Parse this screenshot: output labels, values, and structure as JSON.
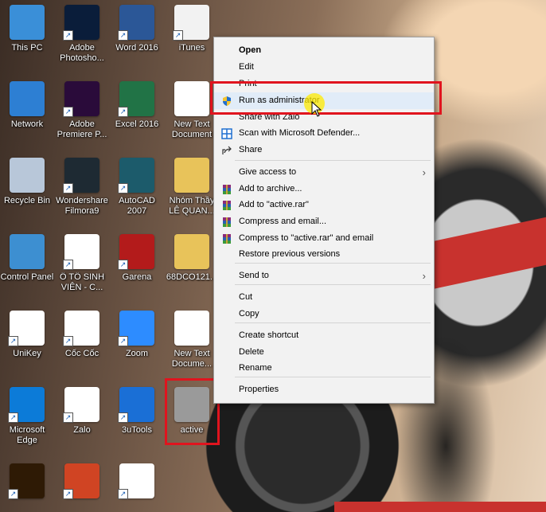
{
  "desktop_icons": [
    {
      "label": "This PC",
      "icon": "computer-icon",
      "color": "#3a8fd8"
    },
    {
      "label": "Adobe Photosho...",
      "icon": "photoshop-icon",
      "color": "#0a1d3a"
    },
    {
      "label": "Word 2016",
      "icon": "word-icon",
      "color": "#2b5797"
    },
    {
      "label": "iTunes",
      "icon": "itunes-icon",
      "color": "#f2f2f2"
    },
    {
      "label": "Network",
      "icon": "network-icon",
      "color": "#2d7fd3"
    },
    {
      "label": "Adobe Premiere P...",
      "icon": "premiere-icon",
      "color": "#2a0b3a"
    },
    {
      "label": "Excel 2016",
      "icon": "excel-icon",
      "color": "#217346"
    },
    {
      "label": "New Text Document",
      "icon": "text-document-icon",
      "color": "#ffffff"
    },
    {
      "label": "Recycle Bin",
      "icon": "recycle-bin-icon",
      "color": "#b8c7d9"
    },
    {
      "label": "Wondershare Filmora9",
      "icon": "filmora-icon",
      "color": "#1e2a33"
    },
    {
      "label": "AutoCAD 2007",
      "icon": "autocad-icon",
      "color": "#1c5b6b"
    },
    {
      "label": "Nhóm Thầy LÊ QUAN...",
      "icon": "folder-icon",
      "color": "#e8c35a"
    },
    {
      "label": "Control Panel",
      "icon": "control-panel-icon",
      "color": "#3d8fd1"
    },
    {
      "label": "Ô TÔ SINH VIÊN - C...",
      "icon": "chrome-icon",
      "color": "#ffffff"
    },
    {
      "label": "Garena",
      "icon": "garena-icon",
      "color": "#b31b1b"
    },
    {
      "label": "68DCO121...",
      "icon": "folder-icon",
      "color": "#e8c35a"
    },
    {
      "label": "UniKey",
      "icon": "unikey-icon",
      "color": "#ffffff"
    },
    {
      "label": "Cốc Cốc",
      "icon": "coccoc-icon",
      "color": "#ffffff"
    },
    {
      "label": "Zoom",
      "icon": "zoom-icon",
      "color": "#2d8cff"
    },
    {
      "label": "New Text Docume...",
      "icon": "text-document-icon",
      "color": "#ffffff"
    },
    {
      "label": "Microsoft Edge",
      "icon": "edge-icon",
      "color": "#0c7bd8"
    },
    {
      "label": "Zalo",
      "icon": "zalo-icon",
      "color": "#ffffff"
    },
    {
      "label": "3uTools",
      "icon": "3utools-icon",
      "color": "#1a6fd6"
    },
    {
      "label": "active",
      "icon": "batch-file-icon",
      "color": "#9a9a9a"
    },
    {
      "label": "",
      "icon": "illustrator-icon",
      "color": "#2e1a05"
    },
    {
      "label": "",
      "icon": "powerpoint-icon",
      "color": "#d04423"
    },
    {
      "label": "",
      "icon": "winrar-icon",
      "color": "#ffffff"
    }
  ],
  "context_menu": {
    "items": [
      {
        "label": "Open",
        "bold": true,
        "icon": ""
      },
      {
        "label": "Edit",
        "icon": ""
      },
      {
        "label": "Print",
        "icon": ""
      },
      {
        "label": "Run as administrator",
        "icon": "shield-icon",
        "highlighted": true
      },
      {
        "label": "Share with Zalo",
        "icon": ""
      },
      {
        "label": "Scan with Microsoft Defender...",
        "icon": "defender-icon"
      },
      {
        "label": "Share",
        "icon": "share-icon"
      },
      {
        "label": "Give access to",
        "icon": "",
        "submenu": true
      },
      {
        "label": "Add to archive...",
        "icon": "winrar-icon"
      },
      {
        "label": "Add to \"active.rar\"",
        "icon": "winrar-icon"
      },
      {
        "label": "Compress and email...",
        "icon": "winrar-icon"
      },
      {
        "label": "Compress to \"active.rar\" and email",
        "icon": "winrar-icon"
      },
      {
        "label": "Restore previous versions",
        "icon": ""
      },
      {
        "label": "Send to",
        "icon": "",
        "submenu": true
      },
      {
        "label": "Cut",
        "icon": ""
      },
      {
        "label": "Copy",
        "icon": ""
      },
      {
        "label": "Create shortcut",
        "icon": ""
      },
      {
        "label": "Delete",
        "icon": ""
      },
      {
        "label": "Rename",
        "icon": ""
      },
      {
        "label": "Properties",
        "icon": ""
      }
    ],
    "submenu_glyph": "›"
  },
  "colors": {
    "highlight_box": "#e0141e",
    "menu_bg": "#f2f2f2",
    "menu_hover": "#e1ecf8"
  }
}
